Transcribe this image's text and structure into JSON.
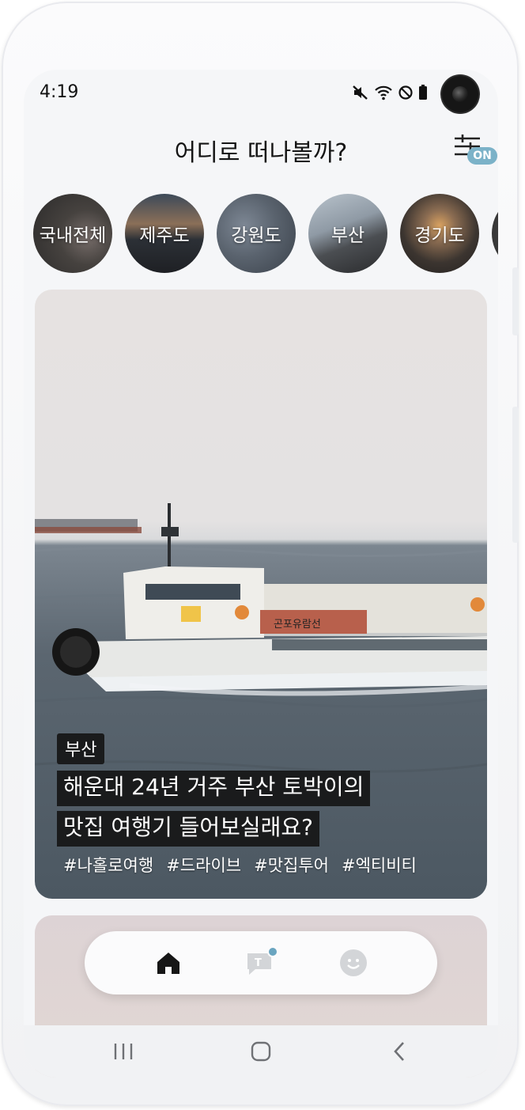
{
  "status_bar": {
    "time": "4:19"
  },
  "header": {
    "title": "어디로 떠나볼까?",
    "filter_badge": "ON"
  },
  "regions": [
    {
      "label": "국내전체"
    },
    {
      "label": "제주도"
    },
    {
      "label": "강원도"
    },
    {
      "label": "부산"
    },
    {
      "label": "경기도"
    }
  ],
  "featured": {
    "tag": "부산",
    "title_line1": "해운대 24년 거주 부산 토박이의",
    "title_line2": "맛집 여행기 들어보실래요?",
    "hashtags": [
      "#나홀로여행",
      "#드라이브",
      "#맛집투어",
      "#엑티비티"
    ],
    "ship_name": "곤포유람선"
  },
  "tabbar": {
    "items": [
      "home-icon",
      "chat-icon",
      "profile-icon"
    ],
    "active": "home-icon",
    "accent": "#6aa5c0"
  },
  "colors": {
    "on_badge": "#7bb2c8",
    "text": "#151515"
  }
}
